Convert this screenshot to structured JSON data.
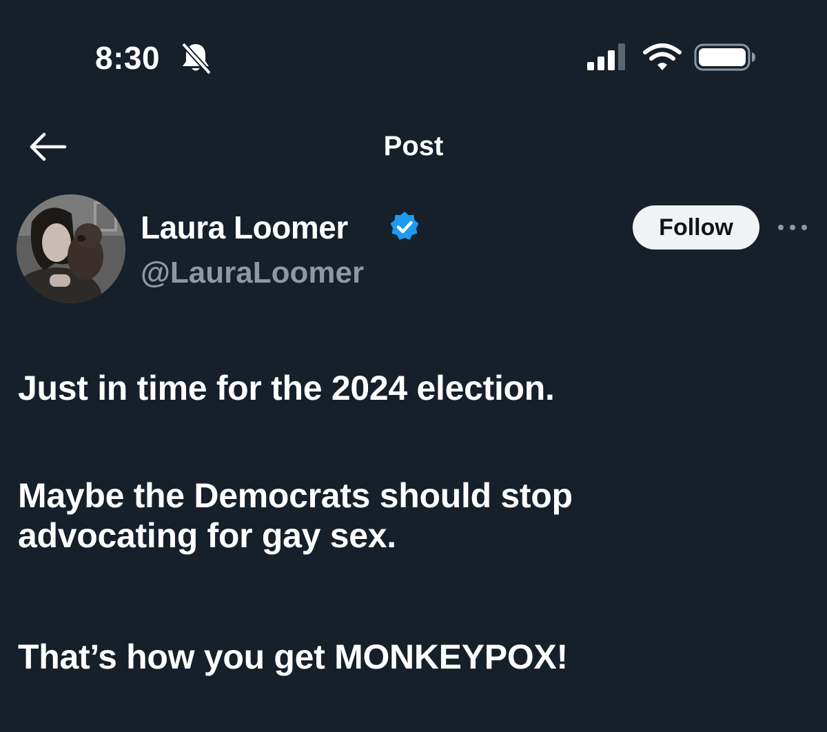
{
  "status_bar": {
    "time": "8:30",
    "icons": [
      "bell-slash-icon",
      "cellular-signal-icon",
      "wifi-icon",
      "battery-icon"
    ]
  },
  "header": {
    "title": "Post",
    "back_icon": "arrow-left-icon"
  },
  "author": {
    "name": "Laura Loomer",
    "handle": "@LauraLoomer",
    "verified": true,
    "avatar_icon": "avatar-photo"
  },
  "actions": {
    "follow_label": "Follow",
    "more_icon": "ellipsis-icon"
  },
  "post": {
    "paragraphs": [
      "Just in time for the 2024 election.",
      "Maybe the Democrats should stop advocating for gay sex.",
      "That’s how you get MONKEYPOX!"
    ]
  },
  "colors": {
    "background": "#15202b",
    "text": "#ffffff",
    "secondary_text": "#8b98a5",
    "verified_blue": "#1d9bf0",
    "follow_button_bg": "#eff3f4"
  }
}
